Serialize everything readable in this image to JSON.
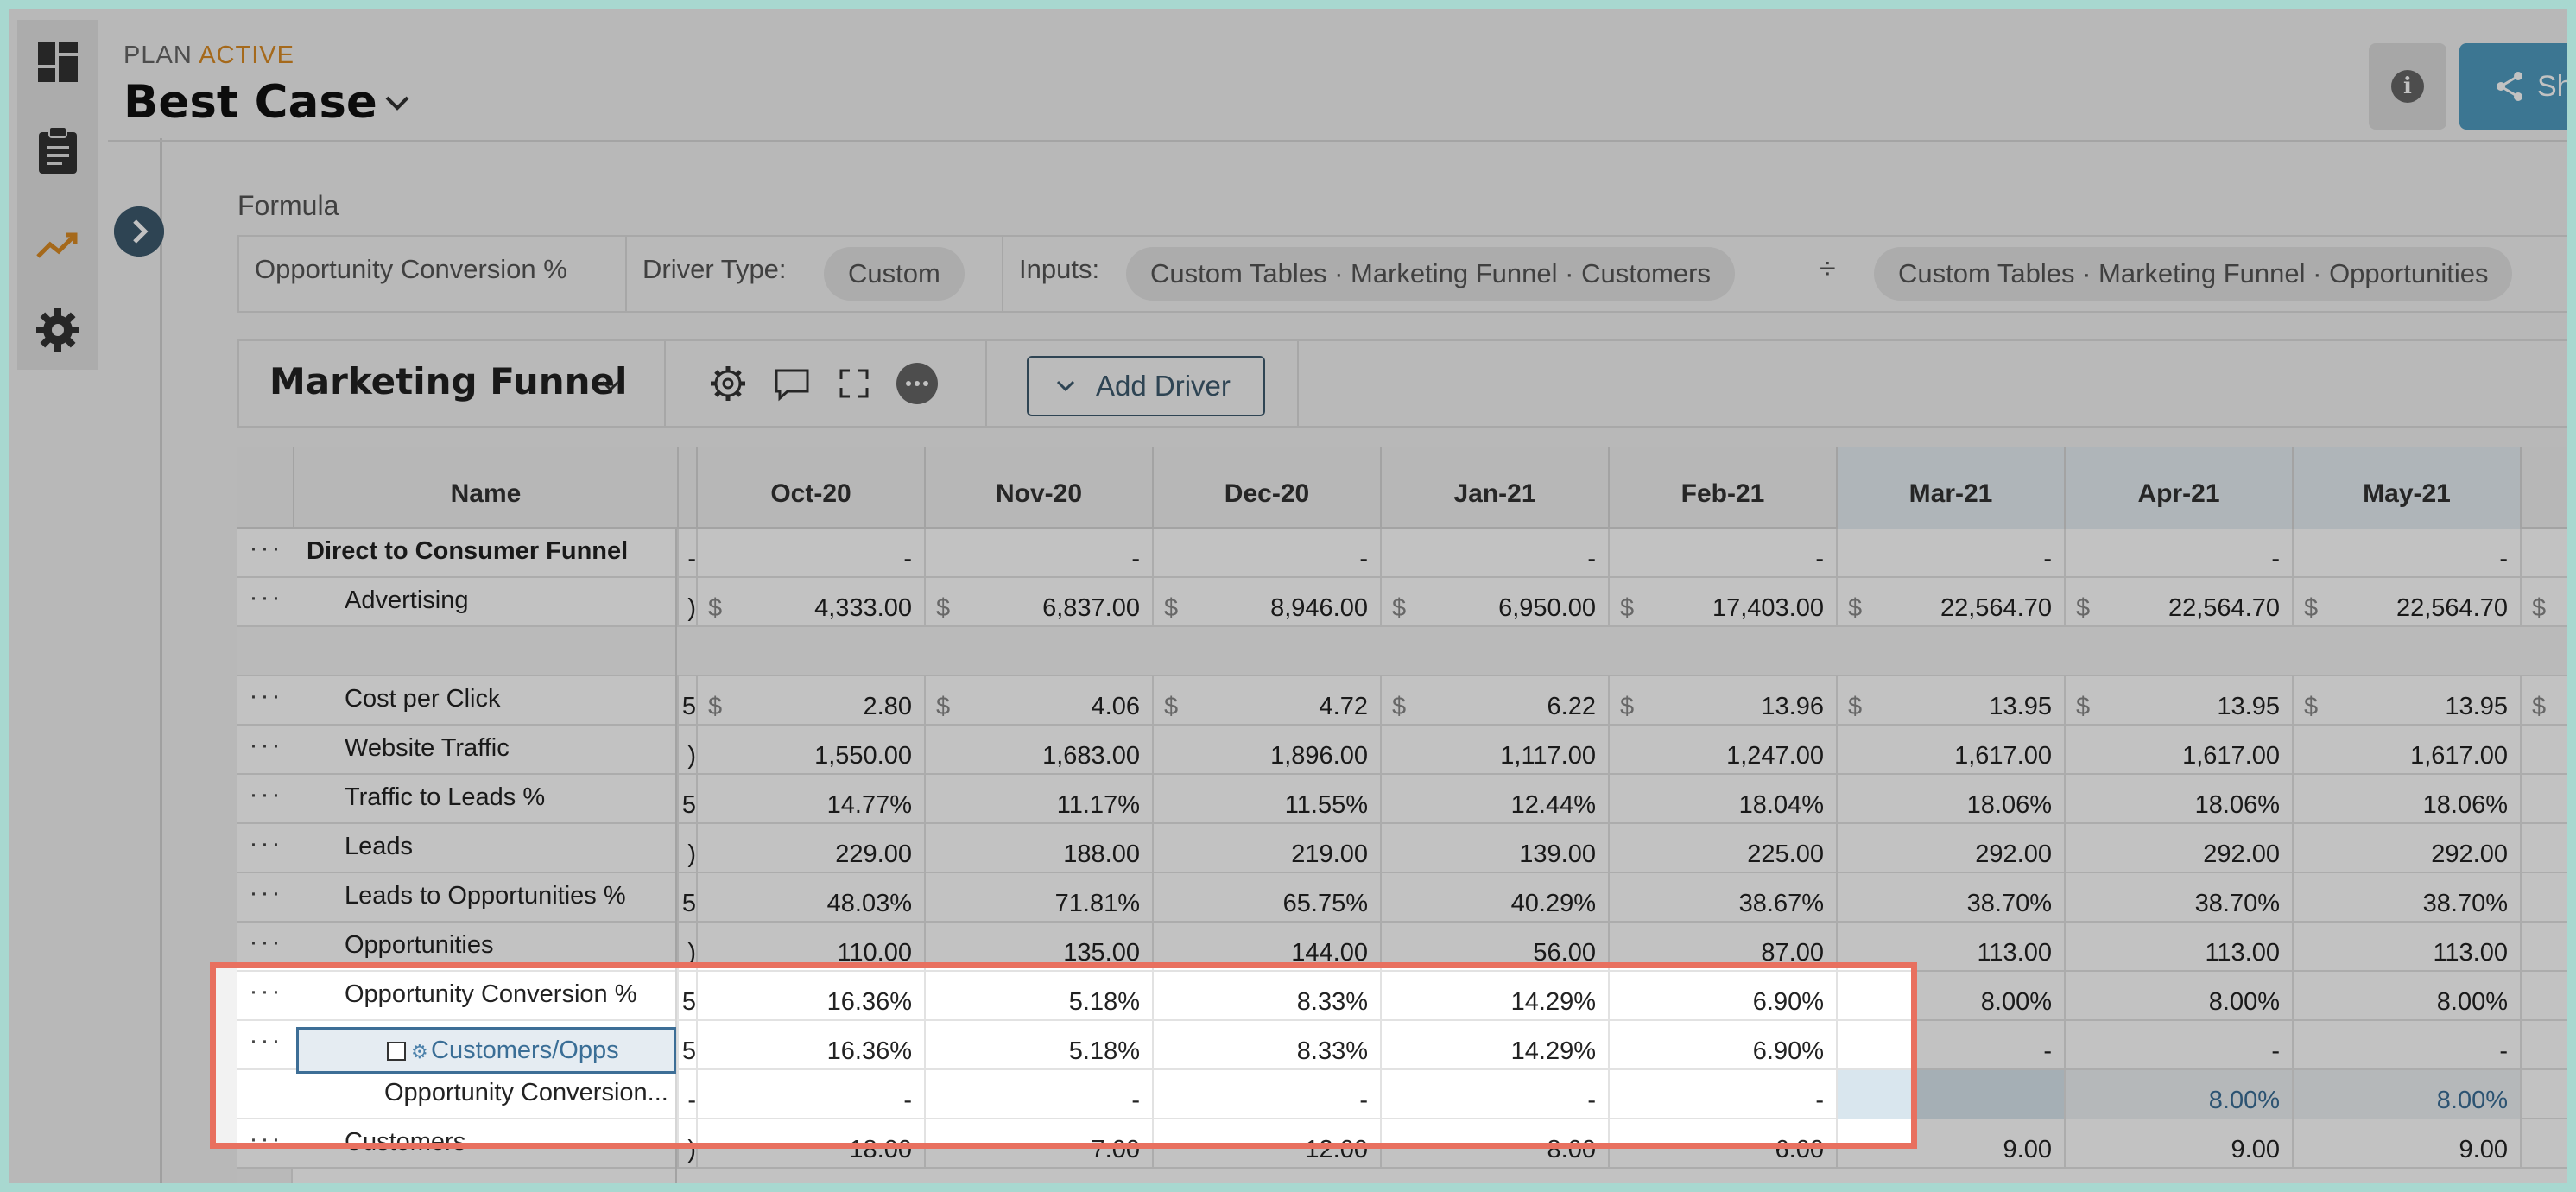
{
  "header": {
    "plan_label": "PLAN",
    "plan_status": "ACTIVE",
    "plan_name": "Best Case",
    "share_label": "Sh"
  },
  "rail": {
    "items": [
      {
        "icon": "dashboard-icon"
      },
      {
        "icon": "clipboard-icon"
      },
      {
        "icon": "trend-icon",
        "active": true
      },
      {
        "icon": "gear-icon"
      }
    ]
  },
  "formula": {
    "label": "Formula",
    "driver_name": "Opportunity Conversion %",
    "driver_type_label": "Driver Type:",
    "driver_type_value": "Custom",
    "inputs_label": "Inputs:",
    "input_a": "Custom Tables · Marketing Funnel · Customers",
    "operator": "÷",
    "input_b": "Custom Tables · Marketing Funnel · Opportunities"
  },
  "toolbar": {
    "table_name": "Marketing Funnel",
    "add_driver_label": "Add Driver",
    "more_label": "···"
  },
  "grid": {
    "name_header": "Name",
    "columns": [
      "Oct-20",
      "Nov-20",
      "Dec-20",
      "Jan-21",
      "Feb-21",
      "Mar-21",
      "Apr-21",
      "May-21"
    ],
    "highlighted_columns": [
      "Mar-21",
      "Apr-21",
      "May-21"
    ],
    "rows": [
      {
        "name": "Direct to Consumer Funnel",
        "bold": true,
        "cut": "-",
        "values": [
          "-",
          "-",
          "-",
          "-",
          "-",
          "-",
          "-",
          "-"
        ]
      },
      {
        "name": "Advertising",
        "cut": ")",
        "currency": "$",
        "values": [
          "4,333.00",
          "6,837.00",
          "8,946.00",
          "6,950.00",
          "17,403.00",
          "22,564.70",
          "22,564.70",
          "22,564.70"
        ]
      },
      {
        "name": "",
        "blank": true,
        "values": []
      },
      {
        "name": "Cost per Click",
        "cut": "5",
        "currency": "$",
        "values": [
          "2.80",
          "4.06",
          "4.72",
          "6.22",
          "13.96",
          "13.95",
          "13.95",
          "13.95"
        ]
      },
      {
        "name": "Website Traffic",
        "cut": ")",
        "values": [
          "1,550.00",
          "1,683.00",
          "1,896.00",
          "1,117.00",
          "1,247.00",
          "1,617.00",
          "1,617.00",
          "1,617.00"
        ]
      },
      {
        "name": "Traffic to Leads %",
        "cut": "5",
        "values": [
          "14.77%",
          "11.17%",
          "11.55%",
          "12.44%",
          "18.04%",
          "18.06%",
          "18.06%",
          "18.06%"
        ]
      },
      {
        "name": "Leads",
        "cut": ")",
        "values": [
          "229.00",
          "188.00",
          "219.00",
          "139.00",
          "225.00",
          "292.00",
          "292.00",
          "292.00"
        ]
      },
      {
        "name": "Leads to Opportunities %",
        "cut": "5",
        "values": [
          "48.03%",
          "71.81%",
          "65.75%",
          "40.29%",
          "38.67%",
          "38.70%",
          "38.70%",
          "38.70%"
        ]
      },
      {
        "name": "Opportunities",
        "cut": ")",
        "values": [
          "110.00",
          "135.00",
          "144.00",
          "56.00",
          "87.00",
          "113.00",
          "113.00",
          "113.00"
        ]
      },
      {
        "name": "Opportunity Conversion %",
        "cut": "5",
        "values": [
          "16.36%",
          "5.18%",
          "8.33%",
          "14.29%",
          "6.90%",
          "8.00%",
          "8.00%",
          "8.00%"
        ]
      },
      {
        "name": "Customers/Opps",
        "selected": true,
        "cut": "5",
        "values": [
          "16.36%",
          "5.18%",
          "8.33%",
          "14.29%",
          "6.90%",
          "-",
          "-",
          "-"
        ]
      },
      {
        "name": "Opportunity Conversion...",
        "nodots": true,
        "cut": "-",
        "values": [
          "-",
          "-",
          "-",
          "-",
          "-",
          "",
          "8.00%",
          "8.00%"
        ],
        "tail": "8.00%"
      },
      {
        "name": "Customers",
        "cut": ")",
        "values": [
          "18.00",
          "7.00",
          "12.00",
          "8.00",
          "6.00",
          "9.00",
          "9.00",
          "9.00"
        ]
      }
    ]
  },
  "colors": {
    "accent": "#3d5a6e",
    "status_active": "#d98b24",
    "highlight": "#e8705f",
    "link": "#3a6e96"
  }
}
